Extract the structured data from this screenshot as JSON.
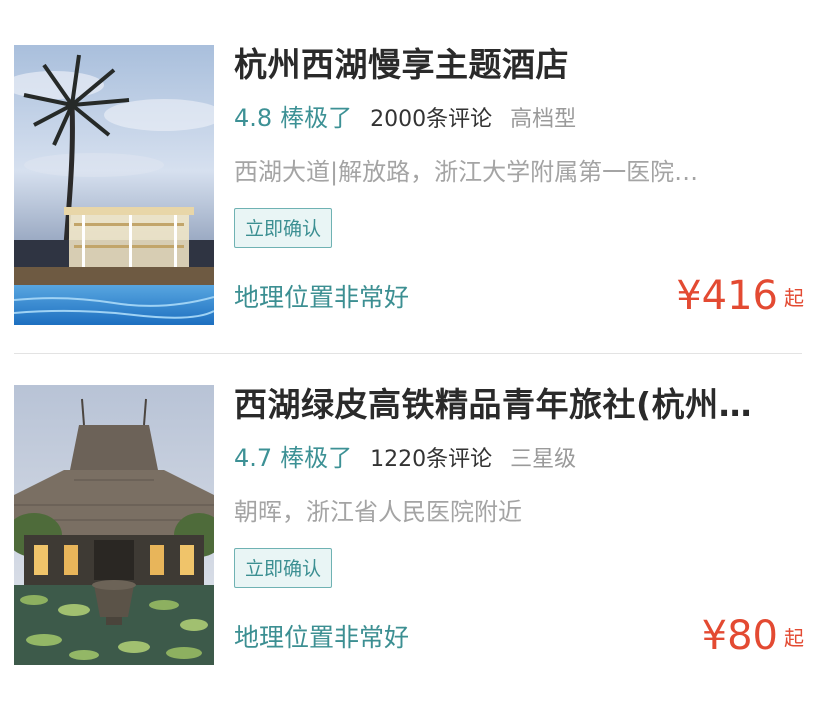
{
  "hotels": [
    {
      "name": "杭州西湖慢享主题酒店",
      "score": "4.8",
      "rating_label": "棒极了",
      "reviews": "2000条评论",
      "grade": "高档型",
      "address": "西湖大道|解放路，浙江大学附属第一医院…",
      "tag": "立即确认",
      "highlight": "地理位置非常好",
      "price": "¥416",
      "price_suffix": "起",
      "image_icon": "palm-pool-photo"
    },
    {
      "name": "西湖绿皮高铁精品青年旅社(杭州…",
      "score": "4.7",
      "rating_label": "棒极了",
      "reviews": "1220条评论",
      "grade": "三星级",
      "address": "朝晖，浙江省人民医院附近",
      "tag": "立即确认",
      "highlight": "地理位置非常好",
      "price": "¥80",
      "price_suffix": "起",
      "image_icon": "temple-lotus-photo"
    }
  ],
  "colors": {
    "accent": "#3d9195",
    "price": "#e34a32",
    "title": "#2a2a2a",
    "muted": "#a4a4a4",
    "tag_bg": "#e9f5f5",
    "tag_border": "#6fb2b3",
    "divider": "#e3e3e3"
  }
}
